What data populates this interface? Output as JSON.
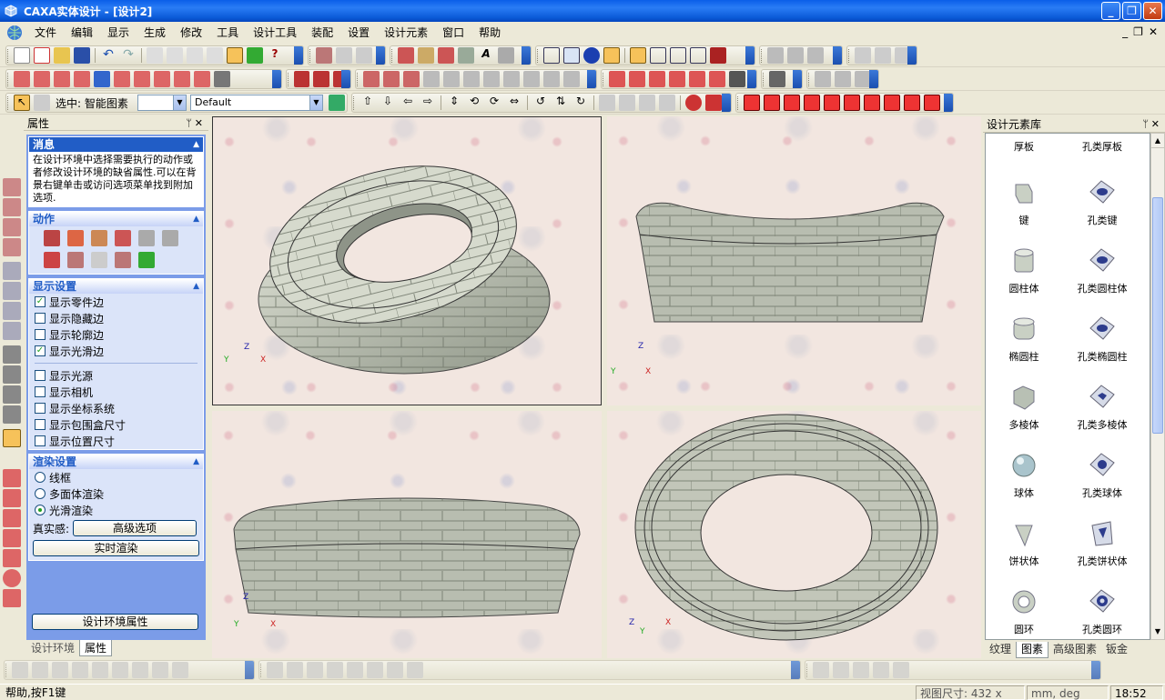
{
  "window": {
    "title": "CAXA实体设计 - [设计2]",
    "buttons": [
      "_",
      "❐",
      "✕"
    ]
  },
  "menubar": {
    "items": [
      "文件",
      "编辑",
      "显示",
      "生成",
      "修改",
      "工具",
      "设计工具",
      "装配",
      "设置",
      "设计元素",
      "窗口",
      "帮助"
    ],
    "mdi_controls": [
      "_",
      "❐",
      "✕"
    ]
  },
  "toolbar3": {
    "selection_label": "选中: 智能图素",
    "style_value": "Default"
  },
  "properties_panel": {
    "title": "属性",
    "message": {
      "header": "消息",
      "text": "在设计环境中选择需要执行的动作或者修改设计环境的缺省属性.可以在背景右键单击或访问选项菜单找到附加选项."
    },
    "actions_header": "动作",
    "display": {
      "header": "显示设置",
      "items": [
        {
          "label": "显示零件边",
          "checked": true
        },
        {
          "label": "显示隐藏边",
          "checked": false
        },
        {
          "label": "显示轮廓边",
          "checked": false
        },
        {
          "label": "显示光滑边",
          "checked": true
        },
        {
          "label": "显示光源",
          "checked": false
        },
        {
          "label": "显示相机",
          "checked": false
        },
        {
          "label": "显示坐标系统",
          "checked": false
        },
        {
          "label": "显示包围盒尺寸",
          "checked": false
        },
        {
          "label": "显示位置尺寸",
          "checked": false
        }
      ]
    },
    "render": {
      "header": "渲染设置",
      "options": [
        {
          "label": "线框",
          "selected": false
        },
        {
          "label": "多面体渲染",
          "selected": false
        },
        {
          "label": "光滑渲染",
          "selected": true
        }
      ],
      "realism_label": "真实感:",
      "advanced_button": "高级选项",
      "realtime_button": "实时渲染"
    },
    "env_button": "设计环境属性",
    "tabs": [
      "设计环境",
      "属性"
    ],
    "active_tab": "属性"
  },
  "viewport": {
    "views": [
      {
        "name": "isometric",
        "axes": [
          "Z",
          "Y",
          "X"
        ]
      },
      {
        "name": "front",
        "axes": [
          "Z",
          "Y",
          "X"
        ]
      },
      {
        "name": "side",
        "axes": [
          "Z",
          "Y",
          "X"
        ]
      },
      {
        "name": "top",
        "axes": [
          "Z",
          "Y",
          "X"
        ]
      }
    ]
  },
  "library": {
    "title": "设计元素库",
    "items": [
      {
        "label": "厚板",
        "icon": "thick-plate-icon"
      },
      {
        "label": "孔类厚板",
        "icon": "hole-thick-plate-icon"
      },
      {
        "label": "键",
        "icon": "key-icon"
      },
      {
        "label": "孔类键",
        "icon": "hole-key-icon"
      },
      {
        "label": "圆柱体",
        "icon": "cylinder-icon"
      },
      {
        "label": "孔类圆柱体",
        "icon": "hole-cylinder-icon"
      },
      {
        "label": "椭圆柱",
        "icon": "elliptic-cylinder-icon"
      },
      {
        "label": "孔类椭圆柱",
        "icon": "hole-elliptic-cylinder-icon"
      },
      {
        "label": "多棱体",
        "icon": "polyprism-icon"
      },
      {
        "label": "孔类多棱体",
        "icon": "hole-polyprism-icon"
      },
      {
        "label": "球体",
        "icon": "sphere-icon"
      },
      {
        "label": "孔类球体",
        "icon": "hole-sphere-icon"
      },
      {
        "label": "饼状体",
        "icon": "pie-icon"
      },
      {
        "label": "孔类饼状体",
        "icon": "hole-pie-icon"
      },
      {
        "label": "圆环",
        "icon": "torus-icon"
      },
      {
        "label": "孔类圆环",
        "icon": "hole-torus-icon"
      }
    ],
    "tabs": [
      "纹理",
      "图素",
      "高级图素",
      "钣金"
    ],
    "active_tab": "图素"
  },
  "status": {
    "help": "帮助,按F1键",
    "view_size": "视图尺寸: 432 x 322",
    "units": "mm, deg",
    "time": "18:52"
  },
  "colors": {
    "title_blue": "#0a5ee8",
    "panel_blue": "#7b9ce8",
    "section_header_blue": "#215dc6",
    "stone": "#c8cbbf",
    "background_pink": "#f2e6e0"
  }
}
